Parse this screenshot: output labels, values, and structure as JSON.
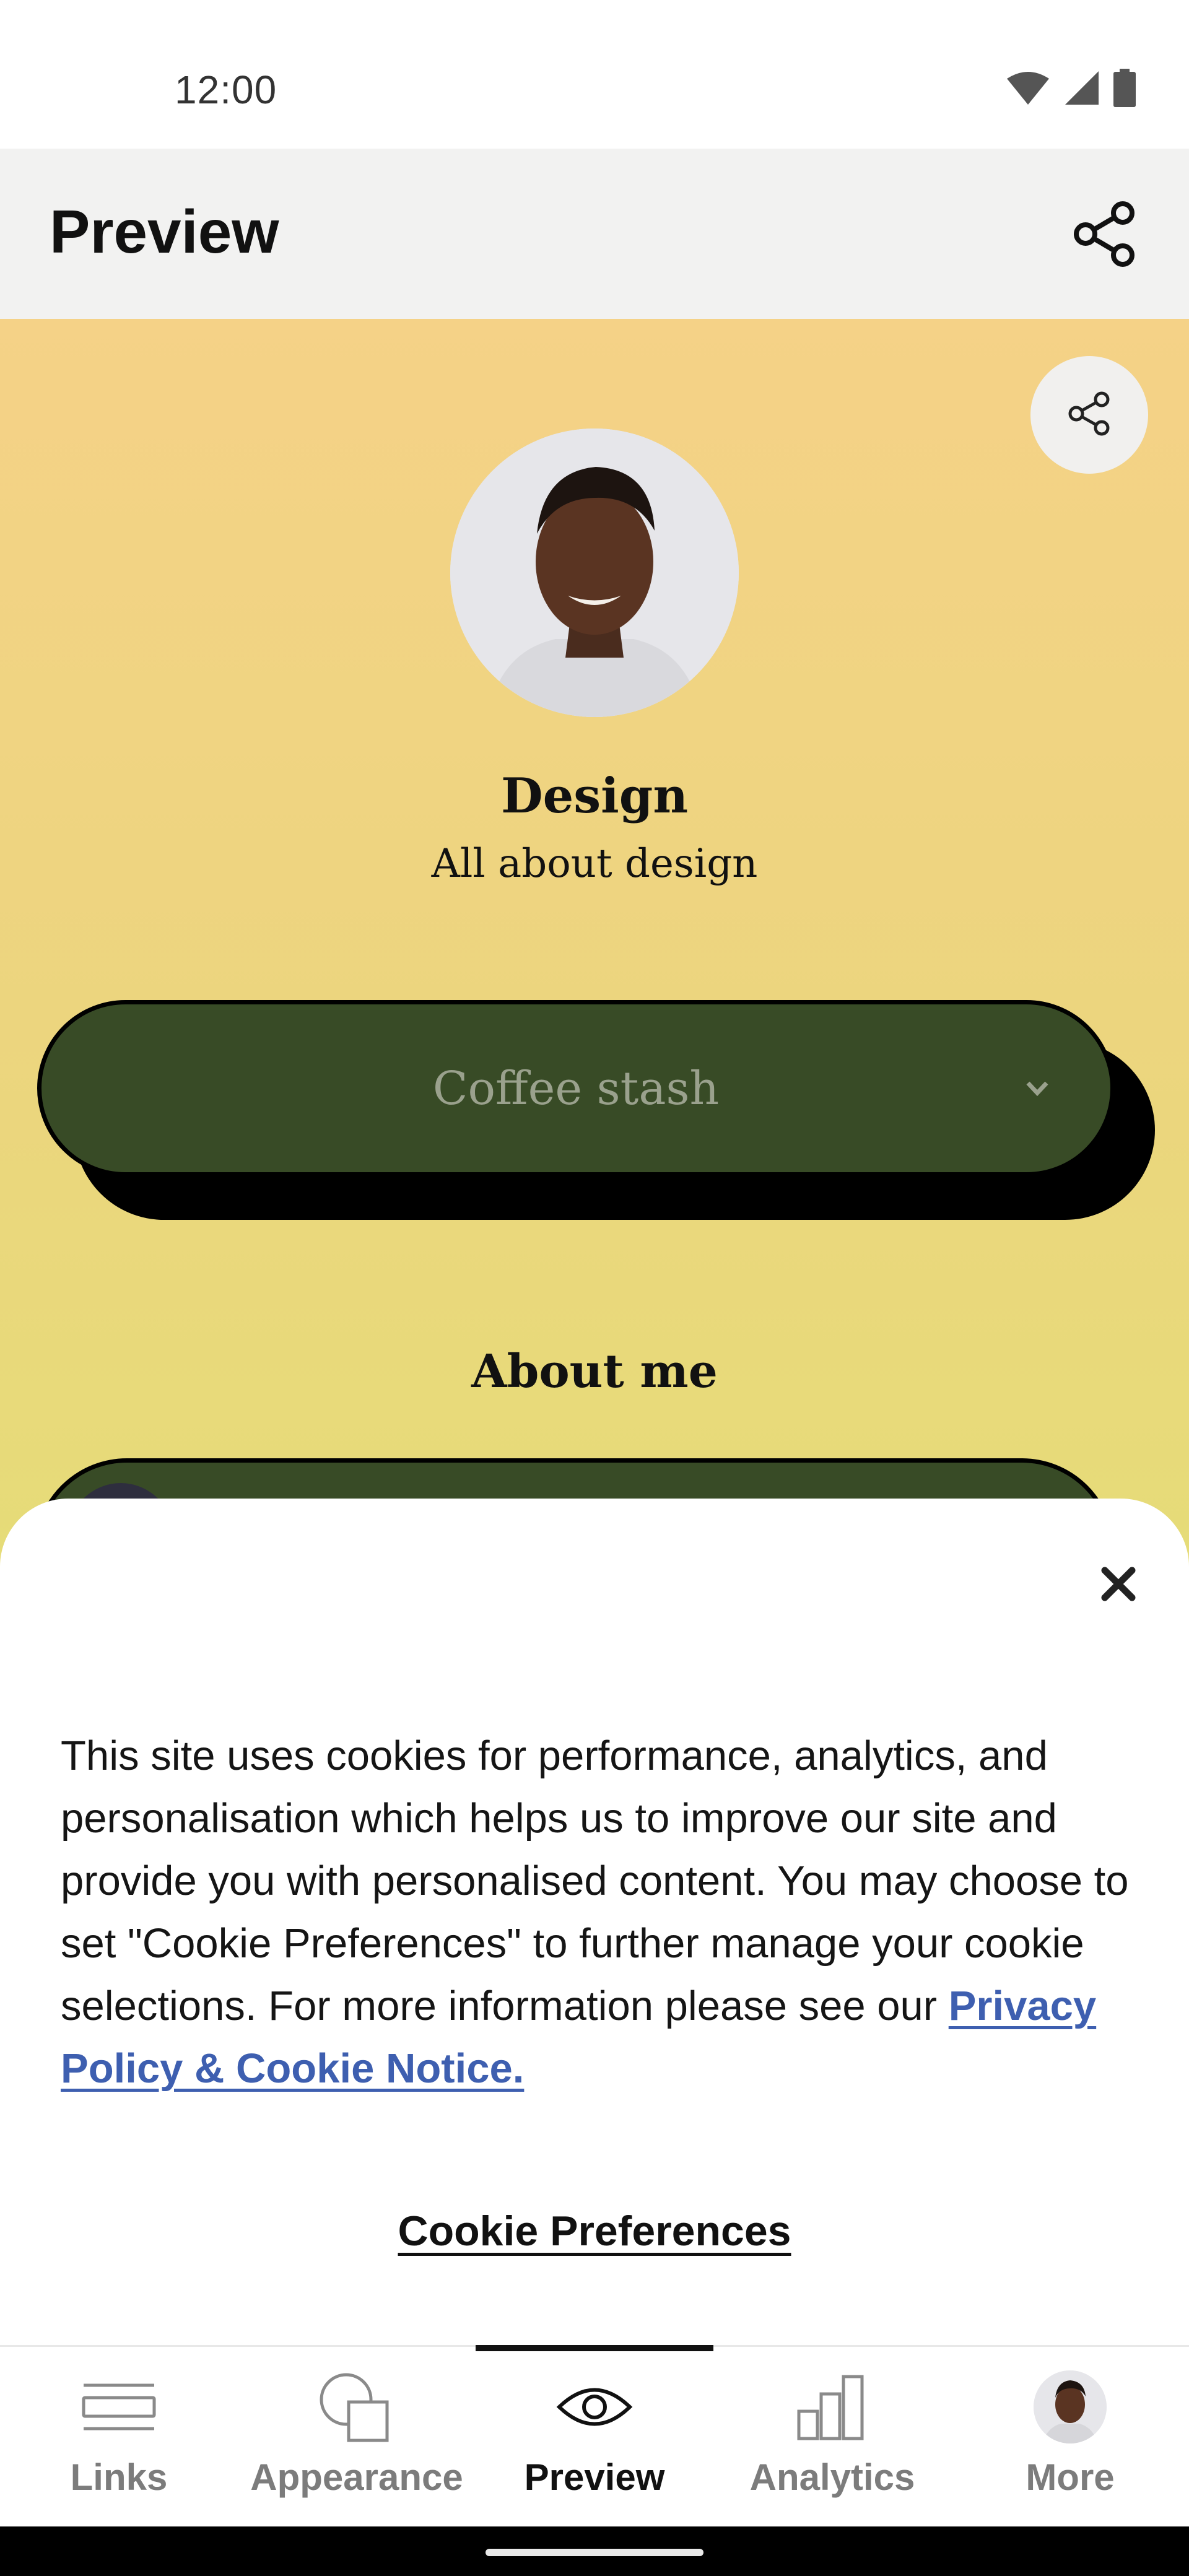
{
  "status_bar": {
    "time": "12:00"
  },
  "app_bar": {
    "title": "Preview"
  },
  "profile": {
    "name": "Design",
    "bio": "All about design"
  },
  "links": [
    {
      "label": "Coffee stash"
    }
  ],
  "section": {
    "title": "About me"
  },
  "cookie_sheet": {
    "message": "This site uses cookies for performance, analytics, and personalisation which helps us to improve our site and provide you with personalised content. You may choose to set \"Cookie Preferences\" to further manage your cookie selections. For more information please see our ",
    "link_text": "Privacy Policy & Cookie Notice.",
    "preferences_label": "Cookie Preferences"
  },
  "bottom_nav": {
    "items": [
      {
        "label": "Links",
        "icon": "links-icon"
      },
      {
        "label": "Appearance",
        "icon": "appearance-icon"
      },
      {
        "label": "Preview",
        "icon": "eye-icon",
        "active": true
      },
      {
        "label": "Analytics",
        "icon": "analytics-icon"
      },
      {
        "label": "More",
        "icon": "avatar"
      }
    ]
  },
  "colors": {
    "link_button": "#384b26",
    "background_top": "#f5d287",
    "background_bottom": "#e0df72",
    "privacy_link": "#3e5fb0"
  }
}
